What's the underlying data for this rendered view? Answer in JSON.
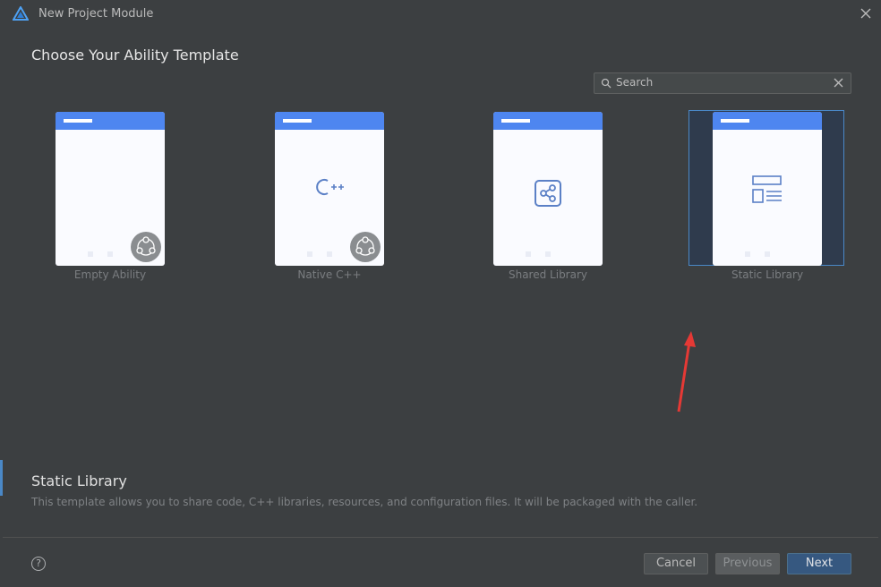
{
  "window": {
    "title": "New Project Module"
  },
  "page": {
    "heading": "Choose Your Ability Template"
  },
  "search": {
    "placeholder": "Search"
  },
  "templates": [
    {
      "label": "Empty Ability",
      "icon": "ability-badge-icon"
    },
    {
      "label": "Native C++",
      "icon": "cpp-icon"
    },
    {
      "label": "Shared Library",
      "icon": "share-icon"
    },
    {
      "label": "Static Library",
      "icon": "layout-list-icon",
      "selected": true
    }
  ],
  "description": {
    "title": "Static Library",
    "text": "This template allows you to share code, C++ libraries, resources, and configuration files. It will be packaged with the caller."
  },
  "footer": {
    "help": "?",
    "cancel": "Cancel",
    "previous": "Previous",
    "next": "Next"
  },
  "colors": {
    "accent": "#4e86f0",
    "selection": "#4a88c7",
    "annotation_arrow": "#e53935"
  }
}
